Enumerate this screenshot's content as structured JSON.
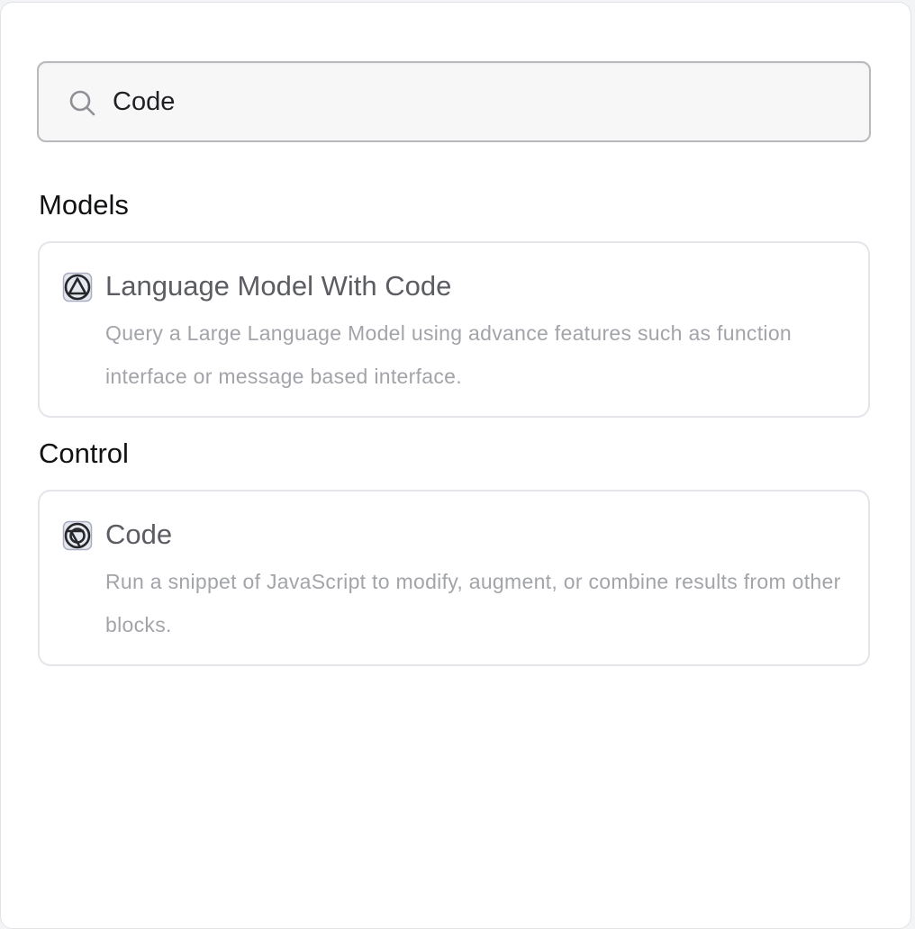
{
  "search": {
    "value": "Code",
    "icon": "search-icon"
  },
  "sections": [
    {
      "heading": "Models",
      "items": [
        {
          "icon": "triangle-circle-icon",
          "title": "Language Model With Code",
          "description": "Query a Large Language Model using advance features such as function interface or message based interface."
        }
      ]
    },
    {
      "heading": "Control",
      "items": [
        {
          "icon": "code-circle-icon",
          "title": "Code",
          "description": "Run a snippet of JavaScript to modify, augment, or combine results from other blocks."
        }
      ]
    }
  ],
  "colors": {
    "title_text": "#5b5d62",
    "description_text": "#a2a4a9",
    "heading_text": "#111214",
    "card_border": "#e4e5e8"
  }
}
